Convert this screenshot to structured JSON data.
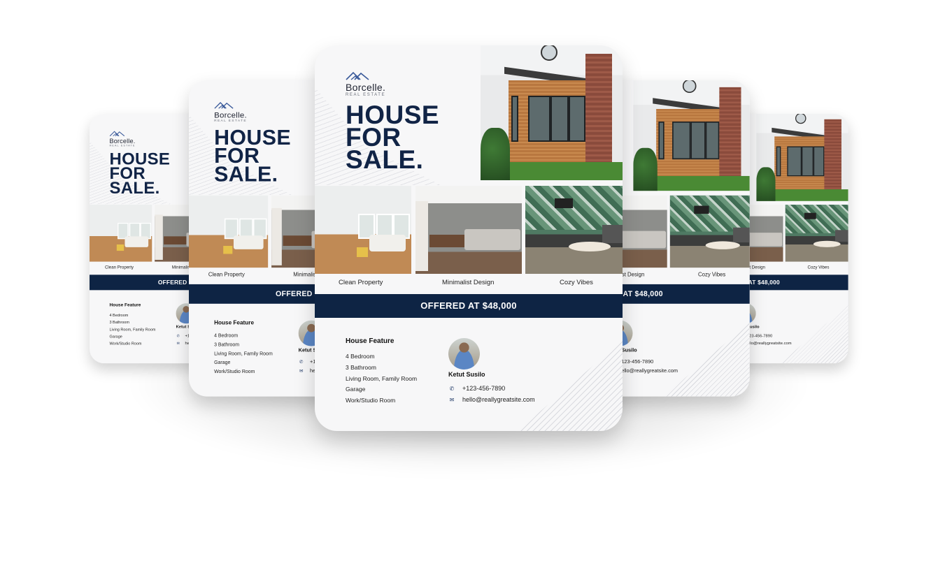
{
  "flyer": {
    "brand": "Borcelle.",
    "brand_sub": "REAL ESTATE",
    "title_lines": [
      "HOUSE",
      "FOR",
      "SALE."
    ],
    "captions": [
      "Clean Property",
      "Minimalist Design",
      "Cozy Vibes"
    ],
    "offer": "OFFERED AT $48,000",
    "features_title": "House Feature",
    "features": [
      "4 Bedroom",
      "3 Bathroom",
      "Living Room, Family Room",
      "Garage",
      "Work/Studio Room"
    ],
    "agent_name": "Ketut Susilo",
    "phone": "+123-456-7890",
    "email": "hello@reallygreatsite.com",
    "icons": {
      "phone": "phone-icon",
      "email": "envelope-icon",
      "logo": "mountain-logo"
    },
    "colors": {
      "navy": "#0e2444",
      "accent": "#3a5a9a"
    }
  }
}
